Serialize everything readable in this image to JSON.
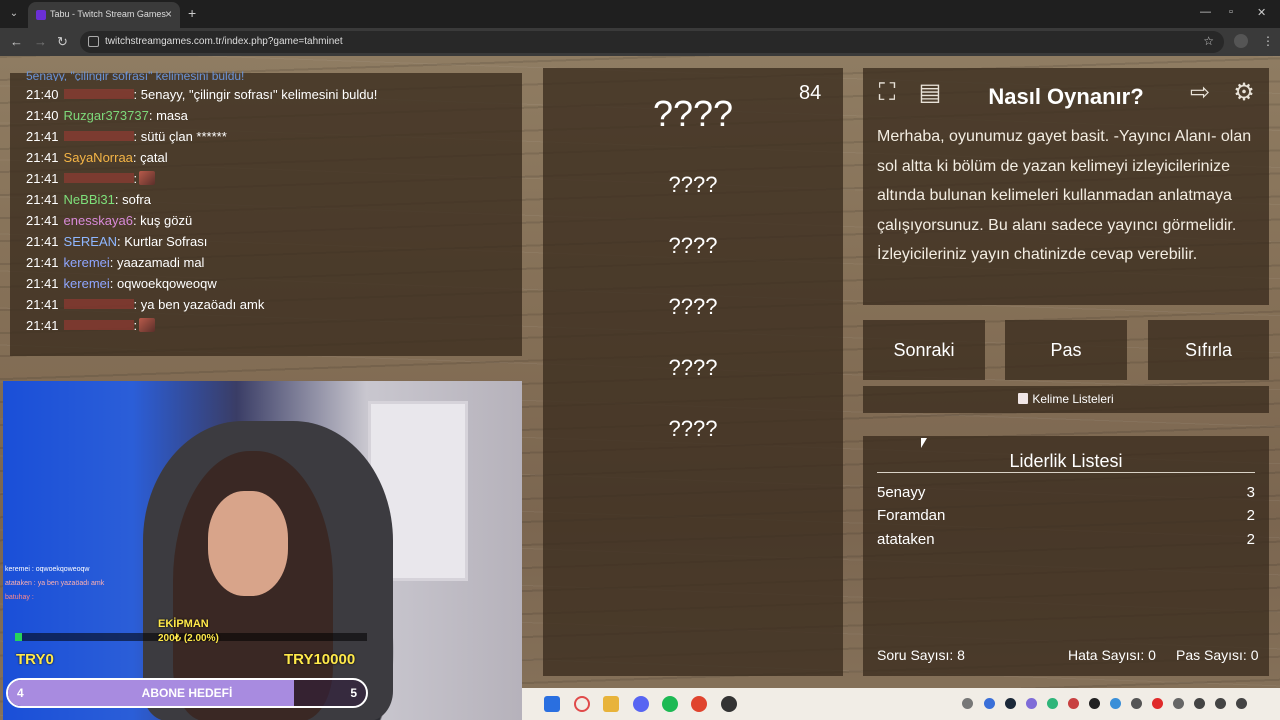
{
  "browser": {
    "tab_title": "Tabu - Twitch Stream Games",
    "url": "twitchstreamgames.com.tr/index.php?game=tahminet"
  },
  "chat": {
    "cut_line": "5enayy, \"çilingir sofrası\" kelimesini buldu!",
    "messages": [
      {
        "time": "21:40",
        "user": "",
        "user_color": "#d83a3a",
        "text": ": 5enayy, \"çilingir sofrası\" kelimesini buldu!",
        "emote": false
      },
      {
        "time": "21:40",
        "user": "Ruzgar373737",
        "user_color": "#7dd87a",
        "text": ": masa",
        "emote": false
      },
      {
        "time": "21:41",
        "user": "",
        "user_color": "#d83a3a",
        "text": ": sütü çlan ******",
        "emote": false
      },
      {
        "time": "21:41",
        "user": "SayaNorraa",
        "user_color": "#f5b546",
        "text": ": çatal",
        "emote": false
      },
      {
        "time": "21:41",
        "user": "",
        "user_color": "#d83a3a",
        "text": ":",
        "emote": true
      },
      {
        "time": "21:41",
        "user": "NeBBi31",
        "user_color": "#7ee07a",
        "text": ": sofra",
        "emote": false
      },
      {
        "time": "21:41",
        "user": "enesskaya6",
        "user_color": "#d88ad8",
        "text": ": kuş gözü",
        "emote": false
      },
      {
        "time": "21:41",
        "user": "SEREAN",
        "user_color": "#8fb7ff",
        "text": ": Kurtlar Sofrası",
        "emote": false
      },
      {
        "time": "21:41",
        "user": "keremei",
        "user_color": "#8fa6ff",
        "text": ": yaazamadi mal",
        "emote": false
      },
      {
        "time": "21:41",
        "user": "keremei",
        "user_color": "#8fa6ff",
        "text": ": oqwoekqoweoqw",
        "emote": false
      },
      {
        "time": "21:41",
        "user": "",
        "user_color": "#d83a3a",
        "text": ": ya ben yazaöadı amk",
        "emote": false
      },
      {
        "time": "21:41",
        "user": "",
        "user_color": "#d83a3a",
        "text": ":",
        "emote": true
      }
    ]
  },
  "stream": {
    "overlay_chat": [
      "keremei : oqwoekqoweoqw",
      "atataken : ya ben yazaöadı amk",
      "batuhay :"
    ],
    "goal_label": "EKİPMAN",
    "goal_amount": "200₺ (2.00%)",
    "goal_progress": 0.02,
    "goal_min": "TRY0",
    "goal_max": "TRY10000",
    "sub_goal_start": "4",
    "sub_goal_label": "ABONE HEDEFİ",
    "sub_goal_end": "5",
    "sub_goal_progress": 0.8
  },
  "game": {
    "timer": "84",
    "main_word": "????",
    "taboo_words": [
      "????",
      "????",
      "????",
      "????",
      "????"
    ]
  },
  "howto": {
    "title": "Nasıl Oynanır?",
    "text": "Merhaba, oyunumuz gayet basit. -Yayıncı Alanı- olan sol altta ki bölüm de yazan kelimeyi izleyicilerinize altında bulunan kelimeleri kullanmadan anlatmaya çalışıyorsunuz. Bu alanı sadece yayıncı görmelidir. İzleyicileriniz yayın chatinizde cevap verebilir."
  },
  "controls": {
    "next": "Sonraki",
    "pass": "Pas",
    "reset": "Sıfırla",
    "word_lists": "Kelime Listeleri"
  },
  "leaderboard": {
    "title": "Liderlik Listesi",
    "rows": [
      {
        "name": "5enayy",
        "score": "3"
      },
      {
        "name": "Foramdan",
        "score": "2"
      },
      {
        "name": "atataken",
        "score": "2"
      }
    ],
    "question_count": "Soru Sayısı: 8",
    "error_count": "Hata Sayısı: 0",
    "pass_count": "Pas Sayısı: 0"
  },
  "icons": [
    "tab-menu-icon",
    "close-icon",
    "plus-icon",
    "back-icon",
    "forward-icon",
    "reload-icon",
    "star-icon",
    "fullscreen-icon",
    "notes-icon",
    "exit-icon",
    "gear-icon"
  ]
}
